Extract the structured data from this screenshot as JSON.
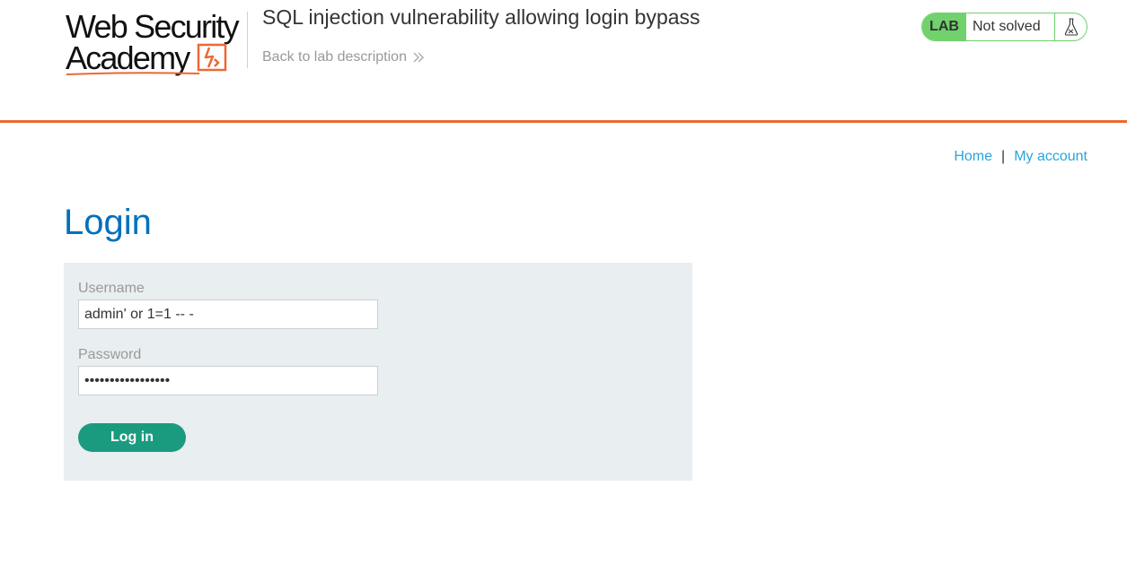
{
  "logo": {
    "line1": "Web Security",
    "line2": "Academy"
  },
  "lab": {
    "title": "SQL injection vulnerability allowing login bypass",
    "back_link": "Back to lab description",
    "badge": "LAB",
    "status": "Not solved",
    "status_color": "#70d16d"
  },
  "nav": {
    "home": "Home",
    "separator": "|",
    "account": "My account"
  },
  "login": {
    "heading": "Login",
    "username_label": "Username",
    "username_value": "admin' or 1=1 -- -",
    "password_label": "Password",
    "password_value": "•••••••••••••••••",
    "submit_label": "Log in"
  },
  "colors": {
    "accent_orange": "#ec6933",
    "heading_blue": "#0071bc",
    "link_blue": "#29a5d9",
    "button_green": "#1a9b80",
    "panel_bg": "#e9eef0"
  }
}
